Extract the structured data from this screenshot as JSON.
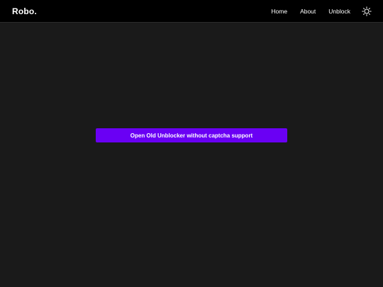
{
  "brand": {
    "name": "Robo."
  },
  "nav": {
    "items": [
      {
        "label": "Home"
      },
      {
        "label": "About"
      },
      {
        "label": "Unblock"
      }
    ],
    "theme_toggle_icon": "sun-icon"
  },
  "main": {
    "cta_label": "Open Old Unblocker without captcha support"
  },
  "colors": {
    "background": "#1a1a1a",
    "navbar": "#000000",
    "accent": "#6a00f4",
    "text": "#ffffff"
  }
}
